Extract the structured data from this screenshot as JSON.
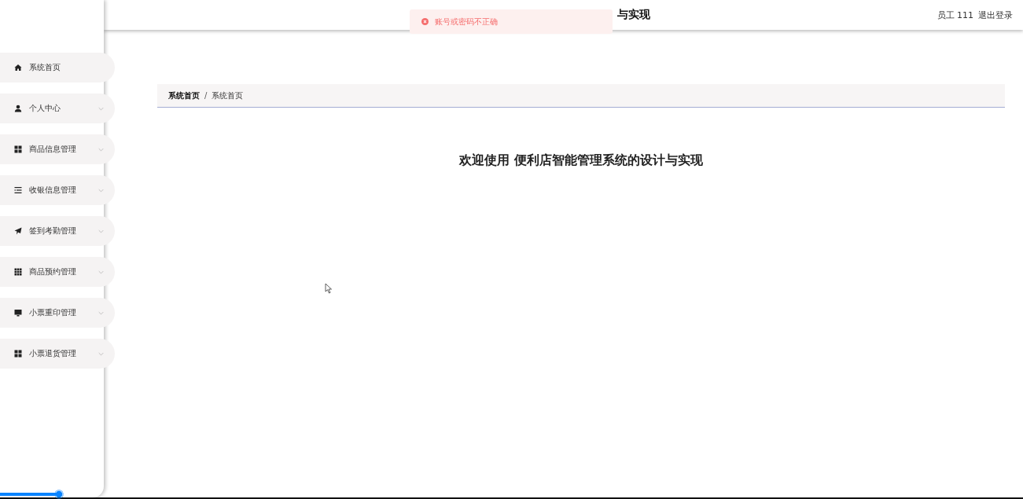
{
  "header": {
    "title": "与实现",
    "user": "员工 111",
    "logout": "退出登录"
  },
  "toast": {
    "message": "账号或密码不正确"
  },
  "sidebar": {
    "items": [
      {
        "label": "系统首页",
        "kind": "home",
        "expandable": false
      },
      {
        "label": "个人中心",
        "kind": "user",
        "expandable": true
      },
      {
        "label": "商品信息管理",
        "kind": "grid4",
        "expandable": true
      },
      {
        "label": "收银信息管理",
        "kind": "list",
        "expandable": true
      },
      {
        "label": "签到考勤管理",
        "kind": "plane",
        "expandable": true
      },
      {
        "label": "商品预约管理",
        "kind": "grid9",
        "expandable": true
      },
      {
        "label": "小票重印管理",
        "kind": "monitor",
        "expandable": true
      },
      {
        "label": "小票退货管理",
        "kind": "grid4",
        "expandable": true
      }
    ]
  },
  "breadcrumb": {
    "items": [
      "系统首页",
      "系统首页"
    ],
    "separator": "/"
  },
  "welcome": "欢迎使用 便利店智能管理系统的设计与实现",
  "progress": {
    "level": 0.062
  }
}
